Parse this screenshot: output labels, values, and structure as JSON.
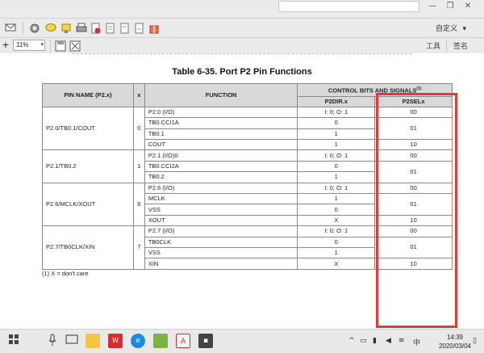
{
  "toolbar": {
    "window_controls": [
      "—",
      "❐",
      "✕"
    ],
    "customize_label": "自定义",
    "customize_caret": "▾",
    "zoom_value": "11%",
    "zoom_caret": "▾",
    "tab_tools": "工具",
    "tab_sign": "签名",
    "icons": [
      "mail-icon",
      "gear-icon",
      "comment-icon",
      "stamp-icon",
      "print-icon",
      "delete-icon",
      "document-icon",
      "document-icon",
      "document-icon",
      "gift-icon",
      "save-icon",
      "fit-page-icon"
    ]
  },
  "document": {
    "table_title": "Table 6-35. Port P2 Pin Functions",
    "headers": {
      "pin_name": "PIN NAME (P2.x)",
      "x": "x",
      "function": "FUNCTION",
      "control_group": "CONTROL BITS AND SIGNALS",
      "control_group_note": "(1)",
      "p2dir": "P2DIR.x",
      "p2sel": "P2SELx"
    },
    "groups": [
      {
        "pin": "P2.0/TB0.1/COUT",
        "x": "0",
        "rows": [
          {
            "function": "P2.0 (I/O)",
            "p2dir": "I: 0; O: 1",
            "p2sel": "00"
          },
          {
            "function": "TB0.CCI1A",
            "p2dir": "0",
            "p2sel": "01"
          },
          {
            "function": "TB0.1",
            "p2dir": "1",
            "p2sel": null
          },
          {
            "function": "COUT",
            "p2dir": "1",
            "p2sel": "10"
          }
        ]
      },
      {
        "pin": "P2.1/TB0.2",
        "x": "1",
        "rows": [
          {
            "function": "P2.1 (I/O)0",
            "p2dir": "I: 0; O: 1",
            "p2sel": "00"
          },
          {
            "function": "TB0.CCI2A",
            "p2dir": "0",
            "p2sel": "01"
          },
          {
            "function": "TB0.2",
            "p2dir": "1",
            "p2sel": null
          }
        ]
      },
      {
        "pin": "P2.6/MCLK/XOUT",
        "x": "6",
        "rows": [
          {
            "function": "P2.6 (I/O)",
            "p2dir": "I: 0; O: 1",
            "p2sel": "00"
          },
          {
            "function": "MCLK",
            "p2dir": "1",
            "p2sel": "01"
          },
          {
            "function": "VSS",
            "p2dir": "0",
            "p2sel": null
          },
          {
            "function": "XOUT",
            "p2dir": "X",
            "p2sel": "10"
          }
        ]
      },
      {
        "pin": "P2.7/TB0CLK/XIN",
        "x": "7",
        "rows": [
          {
            "function": "P2.7 (I/O)",
            "p2dir": "I: 0; O: 1",
            "p2sel": "00"
          },
          {
            "function": "TB0CLK",
            "p2dir": "0",
            "p2sel": "01"
          },
          {
            "function": "VSS",
            "p2dir": "1",
            "p2sel": null
          },
          {
            "function": "XIN",
            "p2dir": "X",
            "p2sel": "10"
          }
        ]
      }
    ],
    "footnote": "(1)   X = don't care",
    "highlight_color": "#e53935"
  },
  "taskbar": {
    "tray_caret": "^",
    "ime": "中",
    "clock_time": "14:39",
    "clock_date": "2020/03/04"
  }
}
